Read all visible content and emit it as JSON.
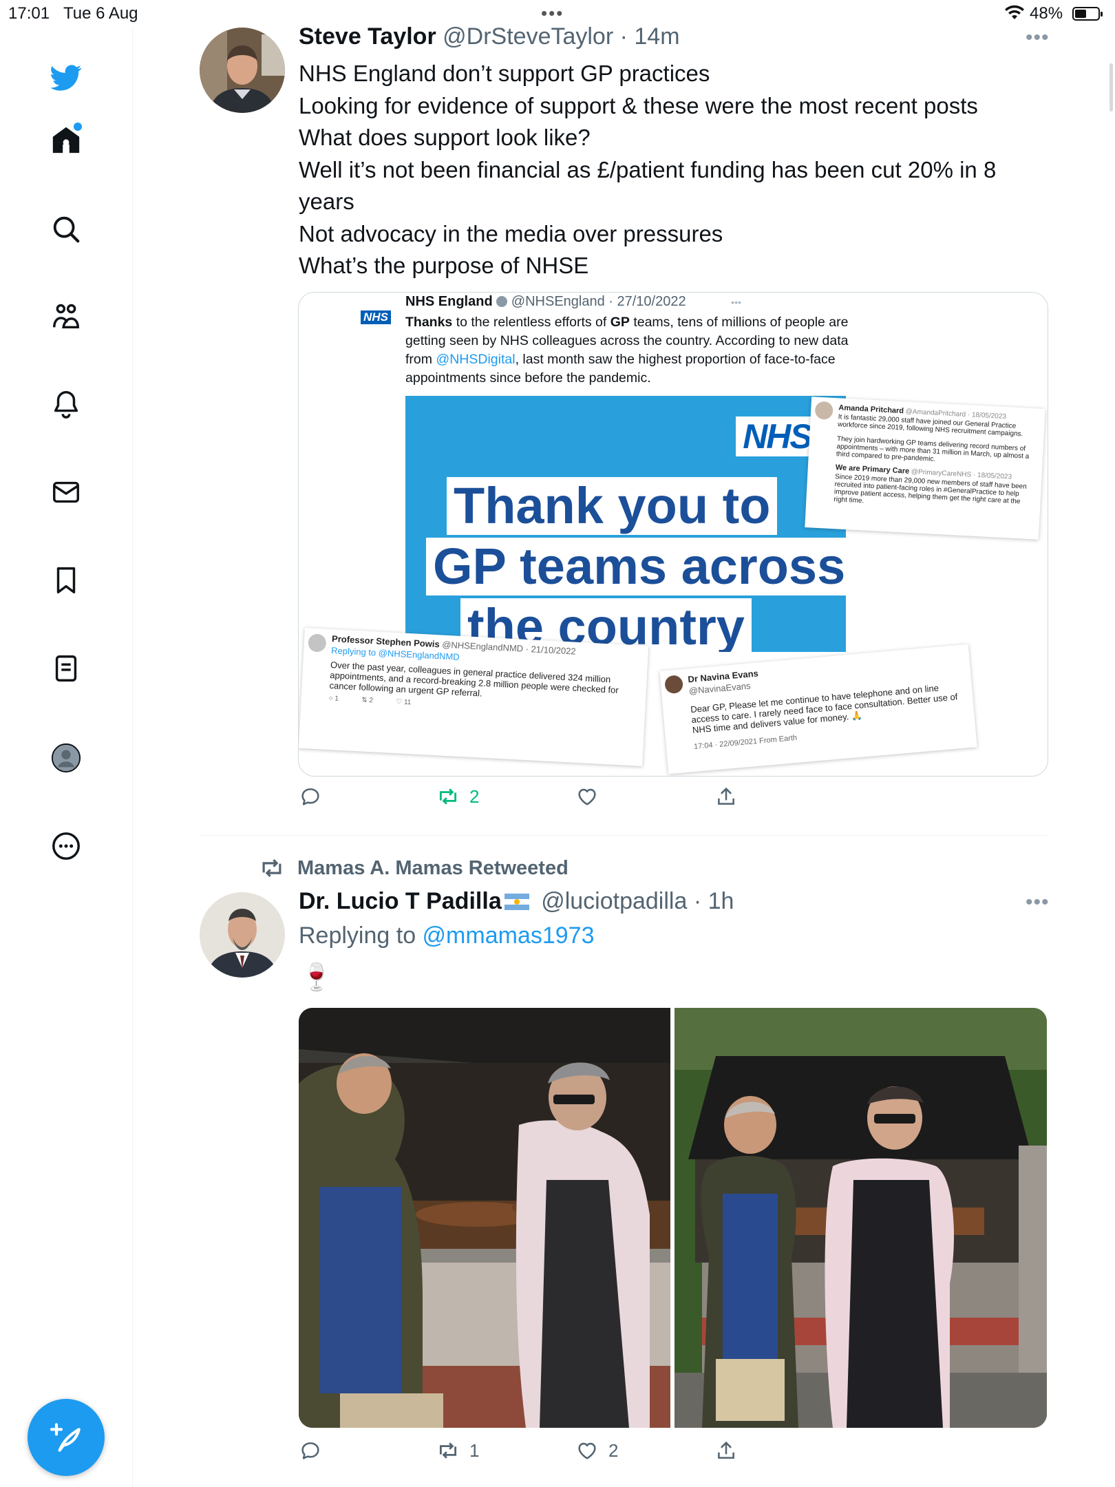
{
  "status_bar": {
    "time": "17:01",
    "date": "Tue 6 Aug",
    "dots": "•••",
    "battery": "48%"
  },
  "sidebar": {
    "items": [
      "twitter-logo",
      "home",
      "explore",
      "communities",
      "notifications",
      "messages",
      "bookmarks",
      "lists",
      "profile",
      "more"
    ]
  },
  "tweet1": {
    "name": "Steve Taylor",
    "handle": "@DrSteveTaylor · 14m",
    "more": "•••",
    "lines": [
      "NHS England don’t support GP practices",
      "Looking for evidence of support & these were the most recent posts",
      "What does support look like?",
      "Well it’s not been financial as £/patient funding has been cut 20% in 8 years",
      "Not advocacy in the media over pressures",
      "What’s the purpose of NHSE"
    ],
    "card": {
      "inner_name": "NHS England",
      "inner_handle": "@NHSEngland · 27/10/2022",
      "inner_more": "•••",
      "inner_logo": "NHS",
      "inner_text_1": "Thanks",
      "inner_text_2": " to the relentless efforts of ",
      "inner_text_3": "GP",
      "inner_text_4": " teams, tens of millions of people are getting seen by NHS colleagues across the country. According to new data from ",
      "inner_text_5": "@NHSDigital",
      "inner_text_6": ", last month saw the highest proportion of face-to-face appointments since before the pandemic.",
      "poster_logo": "NHS",
      "poster_line_1": "Thank you to",
      "poster_line_2": "GP teams across",
      "poster_line_3": "the country",
      "shot_right": {
        "name": "Amanda Pritchard",
        "handle": "@AmandaPritchard · 18/05/2023",
        "text1": "It is fantastic 29,000 staff have joined our General Practice workforce since 2019, following NHS recruitment campaigns.",
        "text2": "They join hardworking GP teams delivering record numbers of appointments – with more than 31 million in March, up almost a third compared to pre-pandemic.",
        "name2": "We are Primary Care",
        "handle2": "@PrimaryCareNHS · 18/05/2023",
        "text3": "Since 2019 more than 29,000 new members of staff have been recruited into patient-facing roles in #GeneralPractice to help improve patient access, helping them get the right care at the right time."
      },
      "shot_left": {
        "name": "Professor Stephen Powis",
        "handle": "@NHSEnglandNMD · 21/10/2022",
        "replying": "Replying to @NHSEnglandNMD",
        "text": "Over the past year, colleagues in general practice delivered 324 million appointments, and a record-breaking 2.8 million people were checked for cancer following an urgent GP referral.",
        "c1": "1",
        "c2": "2",
        "c3": "11"
      },
      "shot_mid": {
        "name": "Dr Navina Evans",
        "handle": "@NavinaEvans",
        "text": "Dear GP, Please let me continue to have telephone and on line access to care. I rarely need face to face consultation. Better use of NHS time and delivers value for money. 🙏",
        "meta": "17:04 · 22/09/2021 From Earth"
      }
    },
    "actions": {
      "reply": "",
      "retweet": "2",
      "like": "",
      "share": ""
    }
  },
  "tweet2": {
    "retweeted_by": "Mamas A. Mamas Retweeted",
    "name": "Dr. Lucio T Padilla",
    "handle": "@luciotpadilla · 1h",
    "more": "•••",
    "replying_prefix": "Replying to ",
    "replying_to": "@mmamas1973",
    "text": "🍷",
    "actions": {
      "reply": "",
      "retweet": "1",
      "like": "2",
      "share": ""
    }
  },
  "colors": {
    "accent": "#1d9bf0",
    "retweet_green": "#00ba7c",
    "muted": "#536471",
    "nhs_blue": "#005eb8"
  }
}
